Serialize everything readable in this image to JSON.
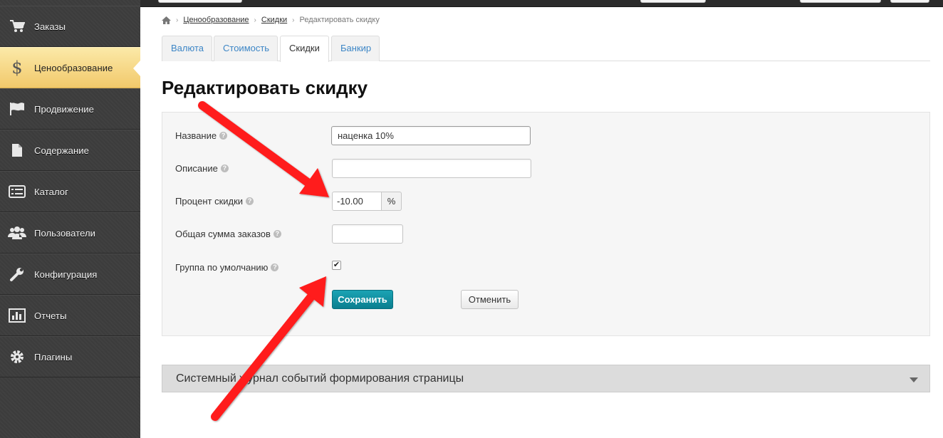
{
  "sidebar": {
    "items": [
      {
        "label": "Заказы",
        "icon": "cart-icon"
      },
      {
        "label": "Ценообразование",
        "icon": "dollar-icon"
      },
      {
        "label": "Продвижение",
        "icon": "flag-icon"
      },
      {
        "label": "Содержание",
        "icon": "document-icon"
      },
      {
        "label": "Каталог",
        "icon": "list-icon"
      },
      {
        "label": "Пользователи",
        "icon": "users-icon"
      },
      {
        "label": "Конфигурация",
        "icon": "wrench-icon"
      },
      {
        "label": "Отчеты",
        "icon": "chart-icon"
      },
      {
        "label": "Плагины",
        "icon": "gear-icon"
      }
    ],
    "active_index": 1
  },
  "breadcrumb": {
    "items": [
      "Ценообразование",
      "Скидки"
    ],
    "current": "Редактировать скидку"
  },
  "tabs": {
    "items": [
      "Валюта",
      "Стоимость",
      "Скидки",
      "Банкир"
    ],
    "active_index": 2
  },
  "page_title": "Редактировать скидку",
  "form": {
    "name": {
      "label": "Название",
      "value": "наценка 10%"
    },
    "description": {
      "label": "Описание",
      "value": ""
    },
    "discount_percent": {
      "label": "Процент скидки",
      "value": "-10.00",
      "unit": "%"
    },
    "total_orders": {
      "label": "Общая сумма заказов",
      "value": ""
    },
    "default_group": {
      "label": "Группа по умолчанию",
      "checked": true,
      "check_mark": "✔"
    },
    "help_mark": "?",
    "save_label": "Сохранить",
    "cancel_label": "Отменить"
  },
  "system_log": {
    "label": "Системный журнал событий формирования страницы"
  },
  "colors": {
    "sidebar_bg": "#3c3c3c",
    "active_item": "#f2c96b",
    "save_button": "#0f8a9b",
    "tab_link": "#3d86c6",
    "annotation": "#ff1a1a"
  }
}
